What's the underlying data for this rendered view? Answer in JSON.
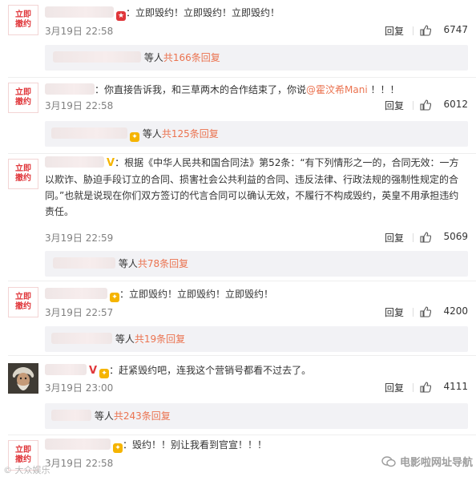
{
  "avatar_text": [
    "立即",
    "撤约"
  ],
  "reply_label": "回复",
  "replies_suffix": "等人",
  "comments": [
    {
      "text": "：立即毁约！立即毁约！立即毁约！",
      "time": "3月19日 22:58",
      "likes": "6747",
      "reply_summary": "共166条回复"
    },
    {
      "text_before": "：你直接告诉我，和三草两木的合作结束了，你说",
      "mention": "@霍汶希Mani",
      "text_after": " ！！！",
      "time": "3月19日 22:58",
      "likes": "6012",
      "reply_summary": "共125条回复"
    },
    {
      "verify": "V",
      "text": "：根据《中华人民共和国合同法》第52条：“有下列情形之一的，合同无效：一方以欺诈、胁迫手段订立的合同、损害社会公共利益的合同、违反法律、行政法规的强制性规定的合同。”也就是说现在你们双方签订的代言合同可以确认无效，不履行不构成毁约，英皇不用承担违约责任。",
      "time": "3月19日 22:59",
      "likes": "5069",
      "reply_summary": "共78条回复"
    },
    {
      "text": "：立即毁约！立即毁约！立即毁约！",
      "time": "3月19日 22:57",
      "likes": "4200",
      "reply_summary": "共19条回复"
    },
    {
      "text": "：赶紧毁约吧，连我这个营销号都看不过去了。",
      "time": "3月19日 23:00",
      "likes": "4111",
      "reply_summary": "共243条回复"
    },
    {
      "text": "：毁约！！别让我看到官宣！！！",
      "time": "3月19日 22:58"
    }
  ],
  "watermark_left": "© 大众娱乐",
  "watermark_right": "电影啦网址导航"
}
